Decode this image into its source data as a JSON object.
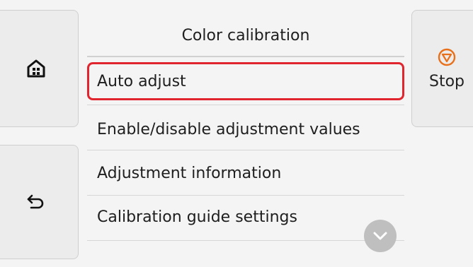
{
  "header": {
    "title": "Color calibration"
  },
  "menu": {
    "items": [
      {
        "label": "Auto adjust",
        "selected": true
      },
      {
        "label": "Enable/disable adjustment values",
        "selected": false
      },
      {
        "label": "Adjustment information",
        "selected": false
      },
      {
        "label": "Calibration guide settings",
        "selected": false
      }
    ]
  },
  "buttons": {
    "home_icon": "home-icon",
    "back_icon": "back-arrow-icon",
    "stop_icon": "stop-icon",
    "stop_label": "Stop",
    "scroll_icon": "chevron-down-icon"
  },
  "colors": {
    "selection_border": "#e1252f",
    "stop_icon": "#e8701a",
    "scroll_button": "#bfbfbf"
  }
}
